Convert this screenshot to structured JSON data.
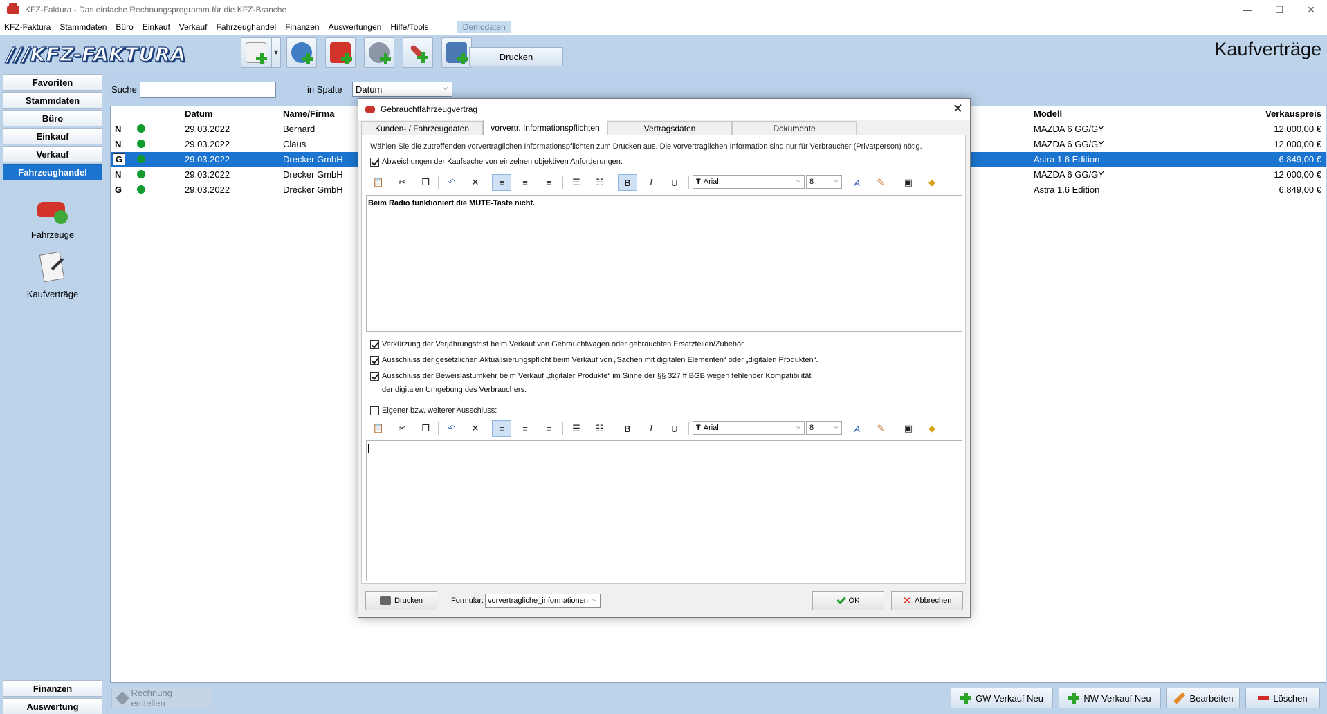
{
  "window": {
    "title": "KFZ-Faktura - Das einfache Rechnungsprogramm für die KFZ-Branche",
    "controls": [
      "—",
      "☐",
      "✕"
    ]
  },
  "menu": {
    "items": [
      "KFZ-Faktura",
      "Stammdaten",
      "Büro",
      "Einkauf",
      "Verkauf",
      "Fahrzeughandel",
      "Finanzen",
      "Auswertungen",
      "Hilfe/Tools"
    ],
    "demo": "Demodaten"
  },
  "toolbar": {
    "logo": "///KFZ-FAKTURA",
    "print_label": "Drucken",
    "page_title": "Kaufverträge"
  },
  "sidebar": {
    "top_buttons": [
      "Favoriten",
      "Stammdaten",
      "Büro",
      "Einkauf",
      "Verkauf",
      "Fahrzeughandel"
    ],
    "active": "Fahrzeughandel",
    "icons": [
      "Fahrzeuge",
      "Kaufverträge"
    ],
    "bottom_buttons": [
      "Finanzen",
      "Auswertung"
    ]
  },
  "search": {
    "label": "Suche",
    "value": "",
    "column_label": "in Spalte",
    "column_value": "Datum"
  },
  "table": {
    "headers": {
      "date": "Datum",
      "name": "Name/Firma",
      "model": "Modell",
      "price": "Verkauspreis"
    },
    "rows": [
      {
        "flag": "N",
        "date": "29.03.2022",
        "name": "Bernard",
        "model": "MAZDA 6 GG/GY",
        "price": "12.000,00 €"
      },
      {
        "flag": "N",
        "date": "29.03.2022",
        "name": "Claus",
        "model": "MAZDA 6 GG/GY",
        "price": "12.000,00 €"
      },
      {
        "flag": "G",
        "date": "29.03.2022",
        "name": "Drecker GmbH",
        "model": "Astra 1.6 Edition",
        "price": "6.849,00 €"
      },
      {
        "flag": "N",
        "date": "29.03.2022",
        "name": "Drecker GmbH",
        "model": "MAZDA 6 GG/GY",
        "price": "12.000,00 €"
      },
      {
        "flag": "G",
        "date": "29.03.2022",
        "name": "Drecker GmbH",
        "model": "Astra 1.6 Edition",
        "price": "6.849,00 €"
      }
    ],
    "selected_row": 2,
    "status_color": "#109c2e",
    "selection_color": "#1b75d0"
  },
  "bottom_bar": {
    "invoice": "Rechnung erstellen",
    "gw_new": "GW-Verkauf Neu",
    "nw_new": "NW-Verkauf Neu",
    "edit": "Bearbeiten",
    "delete": "Löschen"
  },
  "dialog": {
    "title": "Gebrauchtfahrzeugvertrag",
    "tabs": [
      "Kunden- / Fahrzeugdaten",
      "vorvertr. Informationspflichten",
      "Vertragsdaten",
      "Dokumente"
    ],
    "active_tab": 1,
    "info": "Wählen Sie die zutreffenden vorvertraglichen Informationspflichten zum Drucken aus. Die vorvertraglichen Information sind nur für Verbraucher (Privatperson) nötig.",
    "checkbox_deviations": "Abweichungen der Kaufsache von einzelnen objektiven Anforderungen:",
    "editor1_text": "Beim Radio funktioniert die MUTE-Taste nicht.",
    "checks": [
      "Verkürzung der Verjährungsfrist beim Verkauf von Gebrauchtwagen oder gebrauchten Ersatzteilen/Zubehör.",
      "Ausschluss der gesetzlichen Aktualisierungspflicht beim Verkauf von „Sachen mit digitalen Elementen“ oder „digitalen Produkten“.",
      "Ausschluss der Beweislastumkehr beim Verkauf „digitaler Produkte“ im Sinne der §§ 327 ff BGB wegen fehlender Kompatibilität",
      "der digitalen Umgebung des Verbrauchers."
    ],
    "checkbox_own": "Eigener bzw. weiterer Ausschluss:",
    "editor2_text": "",
    "font": "Arial",
    "font_size": "8",
    "print": "Drucken",
    "form_label": "Formular:",
    "form_value": "vorvertragliche_informationen",
    "ok": "OK",
    "cancel": "Abbrechen"
  }
}
